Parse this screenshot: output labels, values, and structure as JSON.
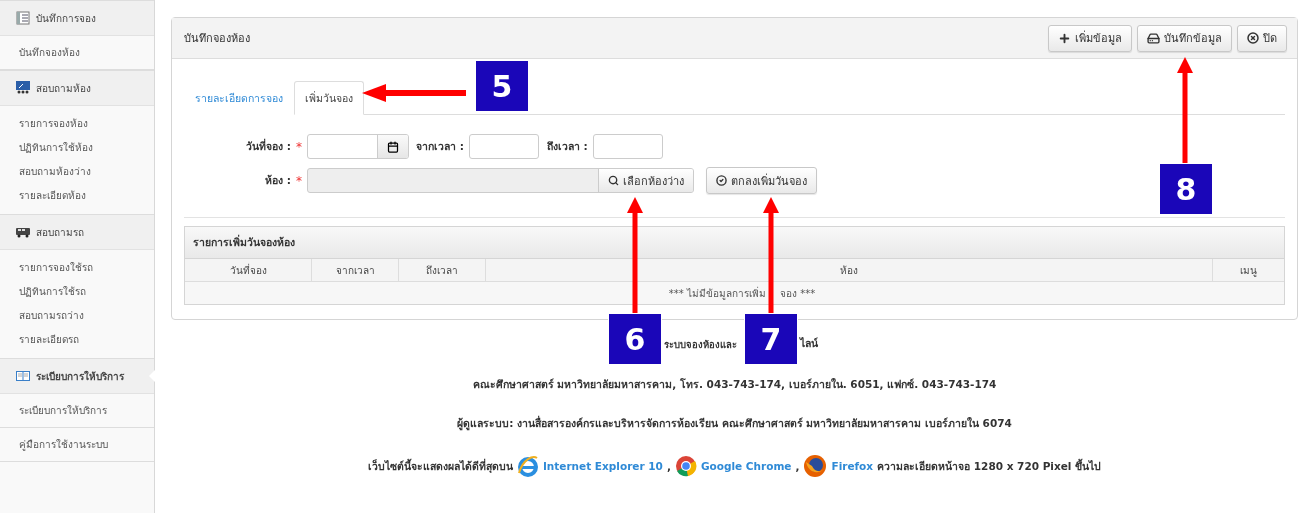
{
  "sidebar": [
    {
      "title": "บันทึกการจอง",
      "selected": false,
      "kind": "rows",
      "items": [
        {
          "label": "บันทึกจองห้อง"
        }
      ]
    },
    {
      "title": "สอบถามห้อง",
      "selected": false,
      "kind": "list",
      "items": [
        {
          "label": "รายการจองห้อง"
        },
        {
          "label": "ปฏิทินการใช้ห้อง"
        },
        {
          "label": "สอบถามห้องว่าง"
        },
        {
          "label": "รายละเอียดห้อง"
        }
      ]
    },
    {
      "title": "สอบถามรถ",
      "selected": false,
      "kind": "list",
      "items": [
        {
          "label": "รายการจองใช้รถ"
        },
        {
          "label": "ปฏิทินการใช้รถ"
        },
        {
          "label": "สอบถามรถว่าง"
        },
        {
          "label": "รายละเอียดรถ"
        }
      ]
    },
    {
      "title": "ระเบียบการให้บริการ",
      "selected": true,
      "kind": "rows",
      "items": [
        {
          "label": "ระเบียบการให้บริการ"
        },
        {
          "label": "คู่มือการใช้งานระบบ"
        }
      ]
    }
  ],
  "panel": {
    "title": "บันทึกจองห้อง",
    "buttons": [
      {
        "label": "เพิ่มข้อมูล"
      },
      {
        "label": "บันทึกข้อมูล"
      },
      {
        "label": "ปิด"
      }
    ]
  },
  "tabs": [
    {
      "label": "รายละเอียดการจอง",
      "selected": false
    },
    {
      "label": "เพิ่มวันจอง",
      "selected": true
    }
  ],
  "form": {
    "date": {
      "label": "วันที่จอง :",
      "mark": "*"
    },
    "from": {
      "label": "จากเวลา :"
    },
    "to": {
      "label": "ถึงเวลา :"
    },
    "room": {
      "label": "ห้อง :",
      "mark": "*"
    },
    "pick_button": "เลือกห้องว่าง",
    "confirm_button": "ตกลงเพิ่มวันจอง"
  },
  "table": {
    "title": "รายการเพิ่มวันจองห้อง",
    "columns": [
      "วันที่จอง",
      "จากเวลา",
      "ถึงเวลา",
      "ห้อง",
      "เมนู"
    ],
    "empty_before": "*** ไม่มีข้อมูลการเพิ่ม",
    "empty_after": "จอง ***"
  },
  "footer": {
    "title_parts": [
      "ระบบจองห้องและ",
      "ไลน์"
    ],
    "contact": "คณะศึกษาศาสตร์ มหาวิทยาลัยมหาสารคาม, โทร. 043-743-174, เบอร์ภายใน. 6051, แฟกซ์. 043-743-174",
    "admin": "ผู้ดูแลระบบ: งานสื่อสารองค์กรและบริหารจัดการห้องเรียน คณะศึกษาศาสตร์ มหาวิทยาลัยมหาสารคาม เบอร์ภายใน 6074",
    "browsers_lead": "เว็บไซต์นี้จะแสดงผลได้ดีที่สุดบน",
    "browsers": [
      {
        "label": "Internet Explorer 10",
        "kind": "ie",
        "after": ","
      },
      {
        "label": "Google Chrome",
        "kind": "chrome",
        "after": ","
      },
      {
        "label": "Firefox",
        "kind": "firefox"
      }
    ],
    "browsers_tail": "ความละเอียดหน้าจอ 1280 x 720 Pixel ขึ้นไป"
  },
  "callouts": [
    {
      "number": "5",
      "kind": "left"
    },
    {
      "number": "6",
      "kind": "up"
    },
    {
      "number": "7",
      "kind": "up"
    },
    {
      "number": "8",
      "kind": "up"
    }
  ]
}
